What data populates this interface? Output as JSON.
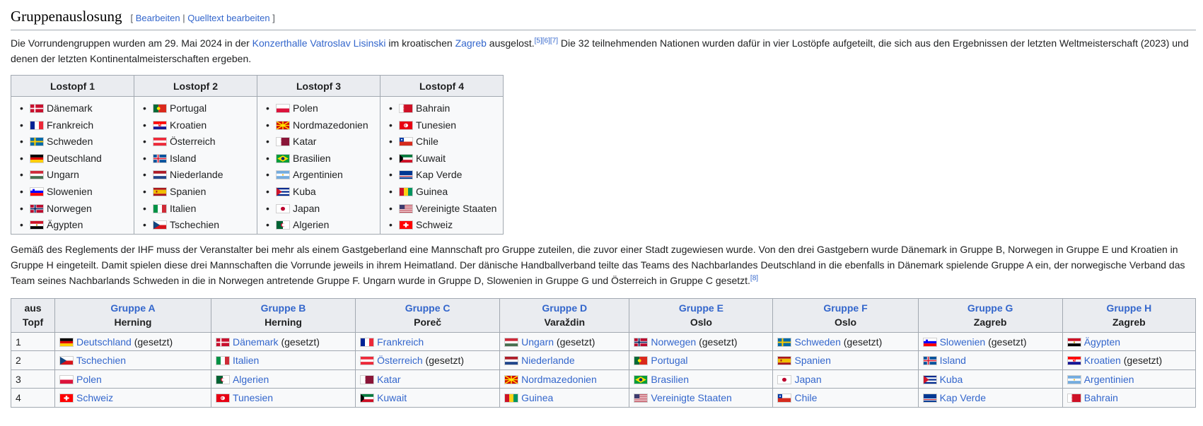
{
  "section": {
    "title": "Gruppenauslosung",
    "edit_open": "[ ",
    "edit_label": "Bearbeiten",
    "edit_sep": " | ",
    "source_label": "Quelltext bearbeiten",
    "edit_close": " ]"
  },
  "intro": {
    "t1": "Die Vorrundengruppen wurden am 29. Mai 2024 in der ",
    "link1": "Konzerthalle Vatroslav Lisinski",
    "t2": " im kroatischen ",
    "link2": "Zagreb",
    "t3": " ausgelost.",
    "refs": "[5][6][7]",
    "t4": " Die 32 teilnehmenden Nationen wurden dafür in vier Lostöpfe aufgeteilt, die sich aus den Ergebnissen der letzten Weltmeisterschaft (2023) und denen der letzten Kontinentalmeisterschaften ergeben."
  },
  "pots": [
    {
      "label": "Lostopf 1",
      "teams": [
        {
          "name": "Dänemark",
          "flag": "dk"
        },
        {
          "name": "Frankreich",
          "flag": "fr"
        },
        {
          "name": "Schweden",
          "flag": "se"
        },
        {
          "name": "Deutschland",
          "flag": "de"
        },
        {
          "name": "Ungarn",
          "flag": "hu"
        },
        {
          "name": "Slowenien",
          "flag": "si"
        },
        {
          "name": "Norwegen",
          "flag": "no"
        },
        {
          "name": "Ägypten",
          "flag": "eg"
        }
      ]
    },
    {
      "label": "Lostopf 2",
      "teams": [
        {
          "name": "Portugal",
          "flag": "pt"
        },
        {
          "name": "Kroatien",
          "flag": "hr"
        },
        {
          "name": "Österreich",
          "flag": "at"
        },
        {
          "name": "Island",
          "flag": "is"
        },
        {
          "name": "Niederlande",
          "flag": "nl"
        },
        {
          "name": "Spanien",
          "flag": "es"
        },
        {
          "name": "Italien",
          "flag": "it"
        },
        {
          "name": "Tschechien",
          "flag": "cz"
        }
      ]
    },
    {
      "label": "Lostopf 3",
      "teams": [
        {
          "name": "Polen",
          "flag": "pl"
        },
        {
          "name": "Nordmazedonien",
          "flag": "mk"
        },
        {
          "name": "Katar",
          "flag": "qa"
        },
        {
          "name": "Brasilien",
          "flag": "br"
        },
        {
          "name": "Argentinien",
          "flag": "ar"
        },
        {
          "name": "Kuba",
          "flag": "cu"
        },
        {
          "name": "Japan",
          "flag": "jp"
        },
        {
          "name": "Algerien",
          "flag": "dz"
        }
      ]
    },
    {
      "label": "Lostopf 4",
      "teams": [
        {
          "name": "Bahrain",
          "flag": "bh"
        },
        {
          "name": "Tunesien",
          "flag": "tn"
        },
        {
          "name": "Chile",
          "flag": "cl"
        },
        {
          "name": "Kuwait",
          "flag": "kw"
        },
        {
          "name": "Kap Verde",
          "flag": "cv"
        },
        {
          "name": "Guinea",
          "flag": "gn"
        },
        {
          "name": "Vereinigte Staaten",
          "flag": "us"
        },
        {
          "name": "Schweiz",
          "flag": "ch"
        }
      ]
    }
  ],
  "rules_text": {
    "t1": "Gemäß des Reglements der IHF muss der Veranstalter bei mehr als einem Gastgeberland eine Mannschaft pro Gruppe zuteilen, die zuvor einer Stadt zugewiesen wurde. Von den drei Gastgebern wurde Dänemark in Gruppe B, Norwegen in Gruppe E und Kroatien in Gruppe H eingeteilt. Damit spielen diese drei Mannschaften die Vorrunde jeweils in ihrem Heimatland. Der dänische Handballverband teilte das Teams des Nachbarlandes Deutschland in die ebenfalls in Dänemark spielende Gruppe A ein, der norwegische Verband das Team seines Nachbarlands Schweden in die in Norwegen antretende Gruppe F. Ungarn wurde in Gruppe D, Slowenien in Gruppe G und Österreich in Gruppe C gesetzt.",
    "refs": "[8]"
  },
  "groups_table": {
    "pot_header_line1": "aus",
    "pot_header_line2": "Topf",
    "groups": [
      {
        "name": "Gruppe A",
        "city": "Herning"
      },
      {
        "name": "Gruppe B",
        "city": "Herning"
      },
      {
        "name": "Gruppe C",
        "city": "Poreč"
      },
      {
        "name": "Gruppe D",
        "city": "Varaždin"
      },
      {
        "name": "Gruppe E",
        "city": "Oslo"
      },
      {
        "name": "Gruppe F",
        "city": "Oslo"
      },
      {
        "name": "Gruppe G",
        "city": "Zagreb"
      },
      {
        "name": "Gruppe H",
        "city": "Zagreb"
      }
    ],
    "rows": [
      {
        "pot": "1",
        "cells": [
          {
            "team": "Deutschland",
            "flag": "de",
            "note": " (gesetzt)"
          },
          {
            "team": "Dänemark",
            "flag": "dk",
            "note": " (gesetzt)"
          },
          {
            "team": "Frankreich",
            "flag": "fr",
            "note": ""
          },
          {
            "team": "Ungarn",
            "flag": "hu",
            "note": " (gesetzt)"
          },
          {
            "team": "Norwegen",
            "flag": "no",
            "note": " (gesetzt)"
          },
          {
            "team": "Schweden",
            "flag": "se",
            "note": " (gesetzt)"
          },
          {
            "team": "Slowenien",
            "flag": "si",
            "note": " (gesetzt)"
          },
          {
            "team": "Ägypten",
            "flag": "eg",
            "note": ""
          }
        ]
      },
      {
        "pot": "2",
        "cells": [
          {
            "team": "Tschechien",
            "flag": "cz",
            "note": ""
          },
          {
            "team": "Italien",
            "flag": "it",
            "note": ""
          },
          {
            "team": "Österreich",
            "flag": "at",
            "note": " (gesetzt)"
          },
          {
            "team": "Niederlande",
            "flag": "nl",
            "note": ""
          },
          {
            "team": "Portugal",
            "flag": "pt",
            "note": ""
          },
          {
            "team": "Spanien",
            "flag": "es",
            "note": ""
          },
          {
            "team": "Island",
            "flag": "is",
            "note": ""
          },
          {
            "team": "Kroatien",
            "flag": "hr",
            "note": " (gesetzt)"
          }
        ]
      },
      {
        "pot": "3",
        "cells": [
          {
            "team": "Polen",
            "flag": "pl",
            "note": ""
          },
          {
            "team": "Algerien",
            "flag": "dz",
            "note": ""
          },
          {
            "team": "Katar",
            "flag": "qa",
            "note": ""
          },
          {
            "team": "Nordmazedonien",
            "flag": "mk",
            "note": ""
          },
          {
            "team": "Brasilien",
            "flag": "br",
            "note": ""
          },
          {
            "team": "Japan",
            "flag": "jp",
            "note": ""
          },
          {
            "team": "Kuba",
            "flag": "cu",
            "note": ""
          },
          {
            "team": "Argentinien",
            "flag": "ar",
            "note": ""
          }
        ]
      },
      {
        "pot": "4",
        "cells": [
          {
            "team": "Schweiz",
            "flag": "ch",
            "note": ""
          },
          {
            "team": "Tunesien",
            "flag": "tn",
            "note": ""
          },
          {
            "team": "Kuwait",
            "flag": "kw",
            "note": ""
          },
          {
            "team": "Guinea",
            "flag": "gn",
            "note": ""
          },
          {
            "team": "Vereinigte Staaten",
            "flag": "us",
            "note": ""
          },
          {
            "team": "Chile",
            "flag": "cl",
            "note": ""
          },
          {
            "team": "Kap Verde",
            "flag": "cv",
            "note": ""
          },
          {
            "team": "Bahrain",
            "flag": "bh",
            "note": ""
          }
        ]
      }
    ]
  },
  "colors": {
    "link": "#3366cc",
    "border": "#a2a9b1",
    "header_bg": "#eaecf0",
    "cell_bg": "#f8f9fa",
    "text": "#202122"
  }
}
